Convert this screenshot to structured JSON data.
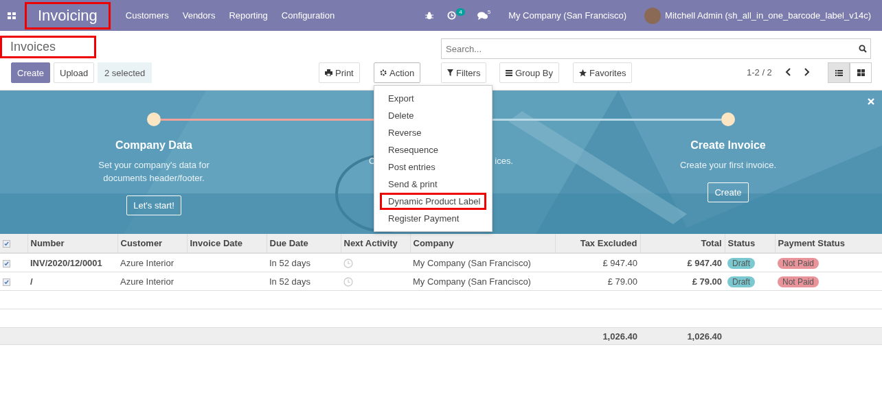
{
  "navbar": {
    "app_name": "Invoicing",
    "app_highlighted": true,
    "menu": [
      "Customers",
      "Vendors",
      "Reporting",
      "Configuration"
    ],
    "activity_count": "4",
    "message_count": "5",
    "company": "My Company (San Francisco)",
    "user": "Mitchell Admin (sh_all_in_one_barcode_label_v14c)"
  },
  "control_panel": {
    "title": "Invoices",
    "title_highlighted": true,
    "create": "Create",
    "upload": "Upload",
    "selected_label": "2 selected",
    "print": "Print",
    "action": "Action",
    "search_placeholder": "Search...",
    "filters": "Filters",
    "group_by": "Group By",
    "favorites": "Favorites",
    "pager": "1-2 / 2",
    "views": [
      {
        "kind": "list",
        "selected": true
      },
      {
        "kind": "kanban",
        "selected": false
      }
    ]
  },
  "action_menu": {
    "items": [
      {
        "label": "Export",
        "highlighted": false
      },
      {
        "label": "Delete",
        "highlighted": false
      },
      {
        "label": "Reverse",
        "highlighted": false
      },
      {
        "label": "Resequence",
        "highlighted": false
      },
      {
        "label": "Post entries",
        "highlighted": false
      },
      {
        "label": "Send & print",
        "highlighted": false
      },
      {
        "label": "Dynamic Product Label",
        "highlighted": true
      },
      {
        "label": "Register Payment",
        "highlighted": false
      }
    ]
  },
  "banner": {
    "steps": [
      {
        "kind": "full",
        "title": "Company Data",
        "description": "Set your company's data for documents header/footer.",
        "button": "Let's start!"
      },
      {
        "kind": "covered",
        "text_before": "C",
        "text_after": "ices."
      },
      {
        "kind": "full",
        "title": "Create Invoice",
        "description": "Create your first invoice.",
        "button": "Create"
      }
    ]
  },
  "table": {
    "all_selected": true,
    "columns": [
      "Number",
      "Customer",
      "Invoice Date",
      "Due Date",
      "Next Activity",
      "Company",
      "Tax Excluded",
      "Total",
      "Status",
      "Payment Status"
    ],
    "rows": [
      {
        "selected": true,
        "number": "INV/2020/12/0001",
        "customer": "Azure Interior",
        "due_date": "In 52 days",
        "company": "My Company (San Francisco)",
        "tax_excluded": "£ 947.40",
        "total": "£ 947.40",
        "status": "Draft",
        "payment_status": "Not Paid"
      },
      {
        "selected": true,
        "number": "/",
        "customer": "Azure Interior",
        "due_date": "In 52 days",
        "company": "My Company (San Francisco)",
        "tax_excluded": "£ 79.00",
        "total": "£ 79.00",
        "status": "Draft",
        "payment_status": "Not Paid"
      }
    ],
    "totals": {
      "tax_excluded": "1,026.40",
      "total": "1,026.40"
    }
  }
}
